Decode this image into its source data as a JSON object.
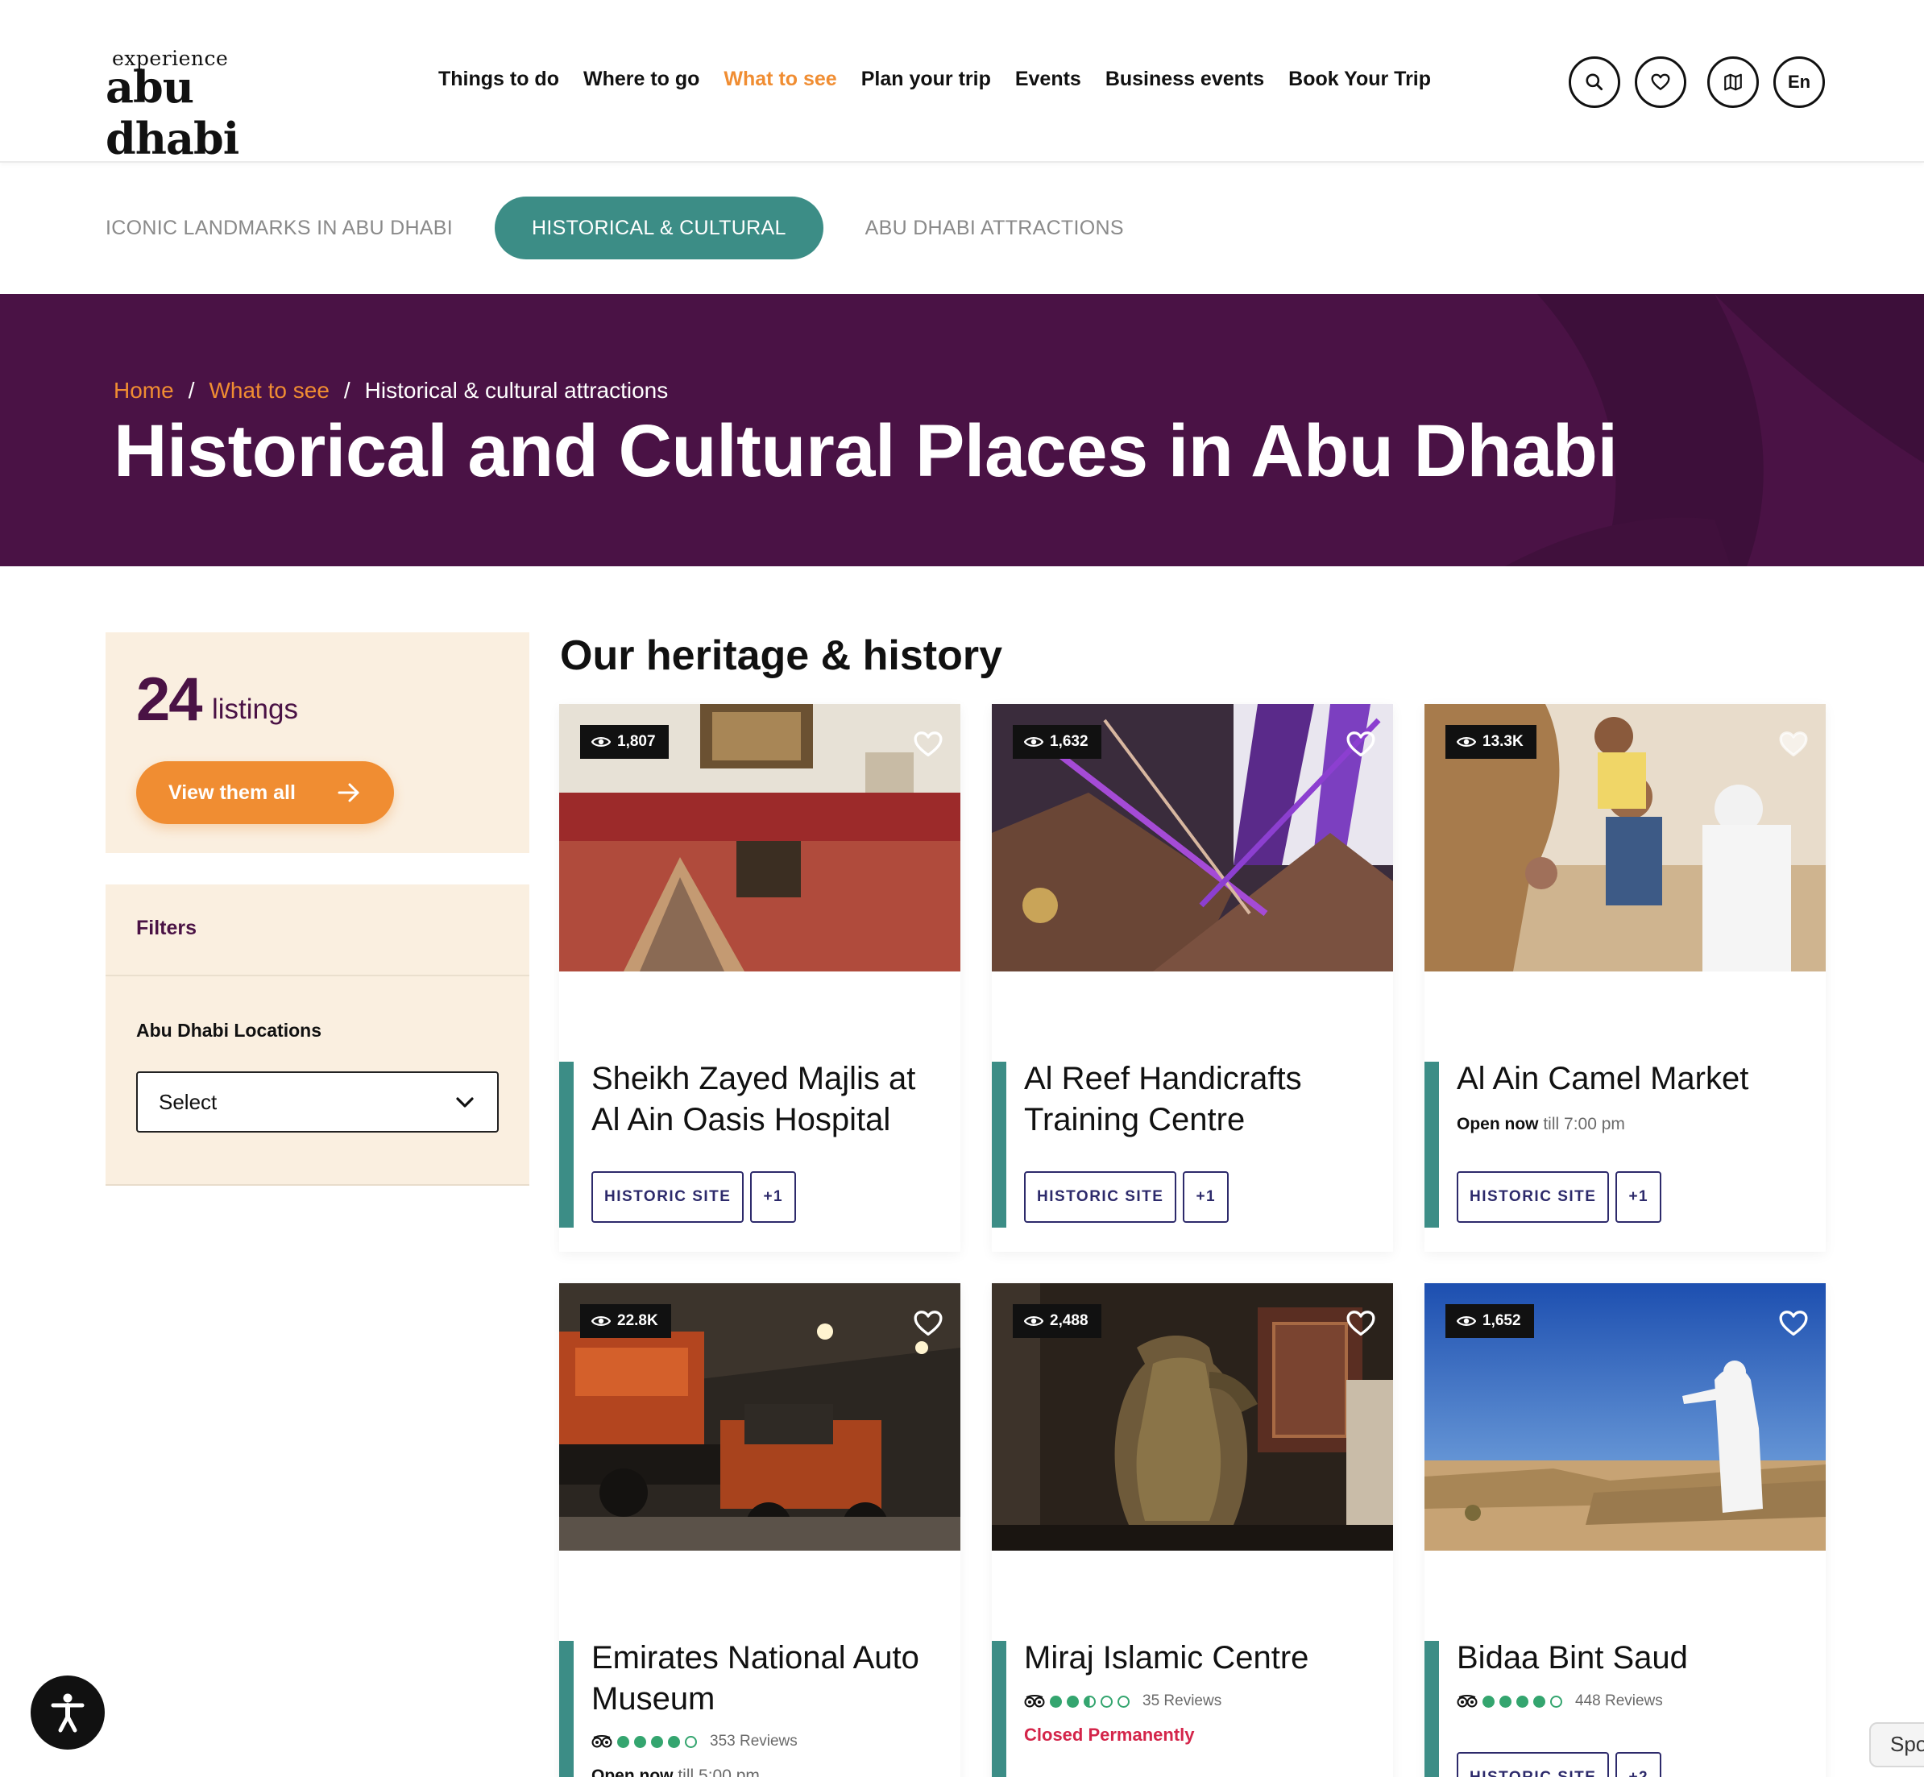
{
  "header": {
    "logo_small": "experience",
    "logo_big": "abu dhabi",
    "nav": [
      {
        "label": "Things to do"
      },
      {
        "label": "Where to go"
      },
      {
        "label": "What to see"
      },
      {
        "label": "Plan your trip"
      },
      {
        "label": "Events"
      },
      {
        "label": "Business events"
      },
      {
        "label": "Book Your Trip"
      }
    ],
    "nav_active": "What to see",
    "icons": [
      "search-icon",
      "heart-icon",
      "map-icon"
    ],
    "language": "En"
  },
  "subtabs": [
    {
      "label": "ICONIC LANDMARKS IN ABU DHABI"
    },
    {
      "label": "HISTORICAL & CULTURAL"
    },
    {
      "label": "ABU DHABI ATTRACTIONS"
    }
  ],
  "hero": {
    "breadcrumb": {
      "home": "Home",
      "section": "What to see",
      "current": "Historical & cultural attractions",
      "separator": "/"
    },
    "title": "Historical and Cultural Places in Abu Dhabi"
  },
  "sidebar": {
    "count": "24",
    "count_label": "listings",
    "view_all": "View them all",
    "filters_title": "Filters",
    "location_label": "Abu Dhabi Locations",
    "location_value": "Select"
  },
  "listings": {
    "title": "Our heritage & history",
    "cards": [
      {
        "views": "1,807",
        "title": "Sheikh Zayed Majlis at Al Ain Oasis Hospital",
        "tag": "HISTORIC SITE",
        "more": "+1"
      },
      {
        "views": "1,632",
        "title": "Al Reef Handicrafts Training Centre",
        "tag": "HISTORIC SITE",
        "more": "+1"
      },
      {
        "views": "13.3K",
        "title": "Al Ain Camel Market",
        "status_open": "Open now",
        "status_rest": "till  7:00 pm",
        "tag": "HISTORIC SITE",
        "more": "+1"
      },
      {
        "views": "22.8K",
        "title": "Emirates National Auto Museum",
        "reviews": "353 Reviews",
        "rating": 4,
        "status_open": "Open now",
        "status_rest": "till  5:00 pm"
      },
      {
        "views": "2,488",
        "title": "Miraj Islamic Centre",
        "reviews": "35 Reviews",
        "rating": 2.5,
        "closed": "Closed Permanently"
      },
      {
        "views": "1,652",
        "title": "Bidaa Bint Saud",
        "reviews": "448 Reviews",
        "rating": 4,
        "tag": "HISTORIC SITE",
        "more": "+2"
      }
    ]
  },
  "floating": {
    "accessibility_icon": "accessibility-icon",
    "partial_button": "Spo"
  },
  "colors": {
    "brand_purple": "#4a1245",
    "accent_orange": "#f08d32",
    "teal": "#3c8d86",
    "tag_navy": "#2d2a6b",
    "closed_red": "#d4254a",
    "rating_green": "#34a56f"
  }
}
